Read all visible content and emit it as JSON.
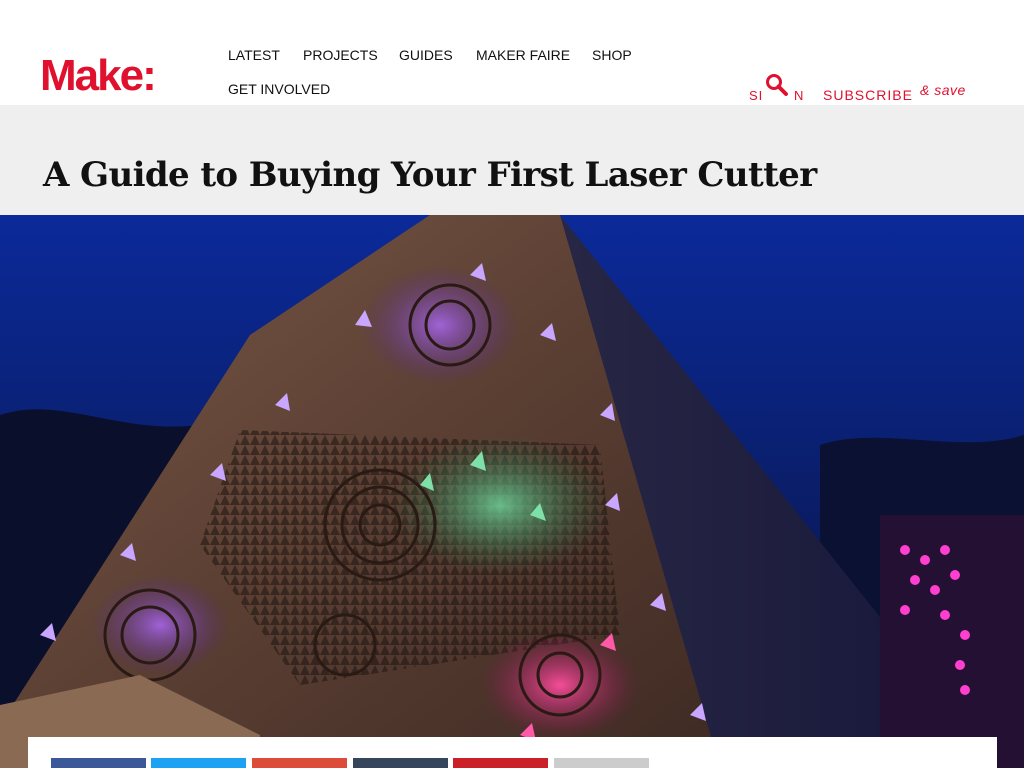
{
  "header": {
    "logo": "Make:",
    "nav": [
      "LATEST",
      "PROJECTS",
      "GUIDES",
      "MAKER FAIRE",
      "SHOP",
      "GET INVOLVED"
    ],
    "sign_in_left": "SI",
    "sign_in_right": "N",
    "subscribe": "SUBSCRIBE",
    "save": "& save"
  },
  "article": {
    "title": "A Guide to Buying Your First Laser Cutter"
  },
  "share": {
    "buttons": [
      {
        "name": "facebook",
        "color": "#3b5998"
      },
      {
        "name": "twitter",
        "color": "#1da1f2"
      },
      {
        "name": "google-plus",
        "color": "#dd4b39"
      },
      {
        "name": "tumblr",
        "color": "#35465c"
      },
      {
        "name": "pinterest",
        "color": "#cb2027"
      },
      {
        "name": "more",
        "color": "#cccccc"
      }
    ]
  },
  "colors": {
    "brand": "#e0102f",
    "title_band": "#efefef"
  }
}
